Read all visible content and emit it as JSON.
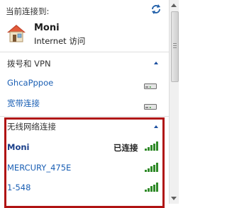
{
  "header": {
    "title": "当前连接到:"
  },
  "current_connection": {
    "name": "Moni",
    "status": "Internet 访问"
  },
  "dialup_section": {
    "title": "拨号和 VPN",
    "items": [
      {
        "label": "GhcaPppoe"
      },
      {
        "label": "宽带连接"
      }
    ]
  },
  "wireless_section": {
    "title": "无线网络连接",
    "networks": [
      {
        "name": "Moni",
        "status": "已连接"
      },
      {
        "name": "MERCURY_475E",
        "status": ""
      },
      {
        "name": "1-548",
        "status": ""
      }
    ]
  },
  "colors": {
    "link": "#1a5fb4",
    "signal": "#2f8a28",
    "highlight_border": "#b01414"
  },
  "icons": [
    "refresh-icon",
    "home-network-icon",
    "modem-icon",
    "wifi-signal-icon",
    "collapse-arrow-icon"
  ]
}
